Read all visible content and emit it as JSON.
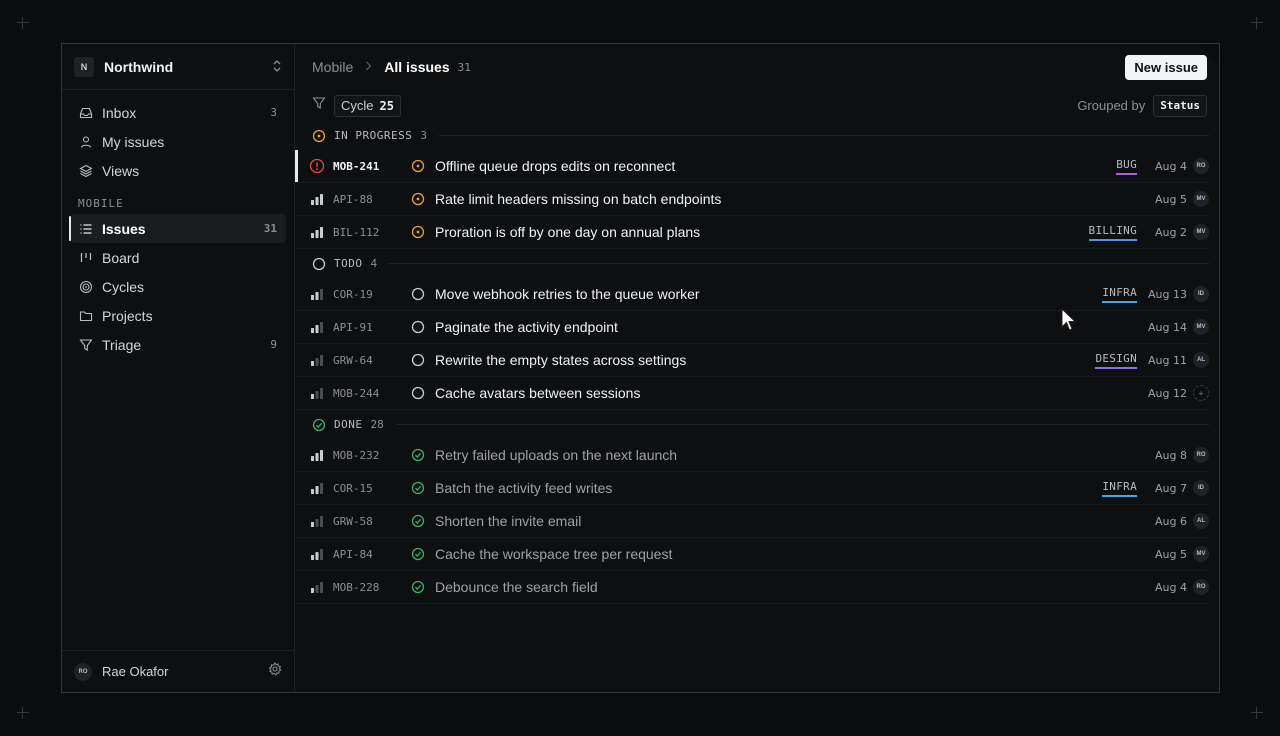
{
  "workspace": {
    "logo": "N",
    "name": "Northwind"
  },
  "nav": {
    "items": [
      {
        "label": "Inbox",
        "count": "3",
        "icon": "inbox-icon"
      },
      {
        "label": "My issues",
        "count": "",
        "icon": "user-icon"
      },
      {
        "label": "Views",
        "count": "",
        "icon": "layers-icon"
      }
    ],
    "section_label": "MOBILE",
    "team_items": [
      {
        "label": "Issues",
        "count": "31",
        "icon": "list-icon",
        "active": true
      },
      {
        "label": "Board",
        "count": "",
        "icon": "board-icon"
      },
      {
        "label": "Cycles",
        "count": "",
        "icon": "cycle-icon"
      },
      {
        "label": "Projects",
        "count": "",
        "icon": "folder-icon"
      },
      {
        "label": "Triage",
        "count": "9",
        "icon": "filter-icon"
      }
    ]
  },
  "user": {
    "initials": "RO",
    "name": "Rae Okafor"
  },
  "breadcrumb": {
    "parent": "Mobile",
    "current": "All issues",
    "count": "31"
  },
  "new_issue_label": "New issue",
  "filter": {
    "chip_label": "Cycle",
    "chip_value": "25"
  },
  "grouping": {
    "label": "Grouped by",
    "value": "Status"
  },
  "colors": {
    "in_progress": "#e8a13a",
    "todo": "#c9ccd1",
    "done": "#3fae6a",
    "urgent": "#e5484d",
    "bug": "#b15bd6",
    "billing": "#5b8ee6",
    "infra": "#4fa3e0",
    "design": "#8a6ee6"
  },
  "groups": [
    {
      "name": "IN PROGRESS",
      "count": "3",
      "status": "in_progress",
      "issues": [
        {
          "id": "MOB-241",
          "priority": "urgent",
          "title": "Offline queue drops edits on reconnect",
          "label": "BUG",
          "label_color": "#b15bd6",
          "date": "Aug 4",
          "assignee": "RO",
          "selected": true
        },
        {
          "id": "API-88",
          "priority": "high",
          "title": "Rate limit headers missing on batch endpoints",
          "label": "",
          "date": "Aug 5",
          "assignee": "MV"
        },
        {
          "id": "BIL-112",
          "priority": "high",
          "title": "Proration is off by one day on annual plans",
          "label": "BILLING",
          "label_color": "#5b8ee6",
          "date": "Aug 2",
          "assignee": "MV"
        }
      ]
    },
    {
      "name": "TODO",
      "count": "4",
      "status": "todo",
      "issues": [
        {
          "id": "COR-19",
          "priority": "medium",
          "title": "Move webhook retries to the queue worker",
          "label": "INFRA",
          "label_color": "#4fa3e0",
          "date": "Aug 13",
          "assignee": "ID"
        },
        {
          "id": "API-91",
          "priority": "medium",
          "title": "Paginate the activity endpoint",
          "label": "",
          "date": "Aug 14",
          "assignee": "MV"
        },
        {
          "id": "GRW-64",
          "priority": "low",
          "title": "Rewrite the empty states across settings",
          "label": "DESIGN",
          "label_color": "#8a6ee6",
          "date": "Aug 11",
          "assignee": "AL"
        },
        {
          "id": "MOB-244",
          "priority": "low",
          "title": "Cache avatars between sessions",
          "label": "",
          "date": "Aug 12",
          "assignee": "+"
        }
      ]
    },
    {
      "name": "DONE",
      "count": "28",
      "status": "done",
      "issues": [
        {
          "id": "MOB-232",
          "priority": "high",
          "title": "Retry failed uploads on the next launch",
          "label": "",
          "date": "Aug 8",
          "assignee": "RO"
        },
        {
          "id": "COR-15",
          "priority": "medium",
          "title": "Batch the activity feed writes",
          "label": "INFRA",
          "label_color": "#4fa3e0",
          "date": "Aug 7",
          "assignee": "ID"
        },
        {
          "id": "GRW-58",
          "priority": "low",
          "title": "Shorten the invite email",
          "label": "",
          "date": "Aug 6",
          "assignee": "AL"
        },
        {
          "id": "API-84",
          "priority": "medium",
          "title": "Cache the workspace tree per request",
          "label": "",
          "date": "Aug 5",
          "assignee": "MV"
        },
        {
          "id": "MOB-228",
          "priority": "low",
          "title": "Debounce the search field",
          "label": "",
          "date": "Aug 4",
          "assignee": "RO"
        }
      ]
    }
  ]
}
